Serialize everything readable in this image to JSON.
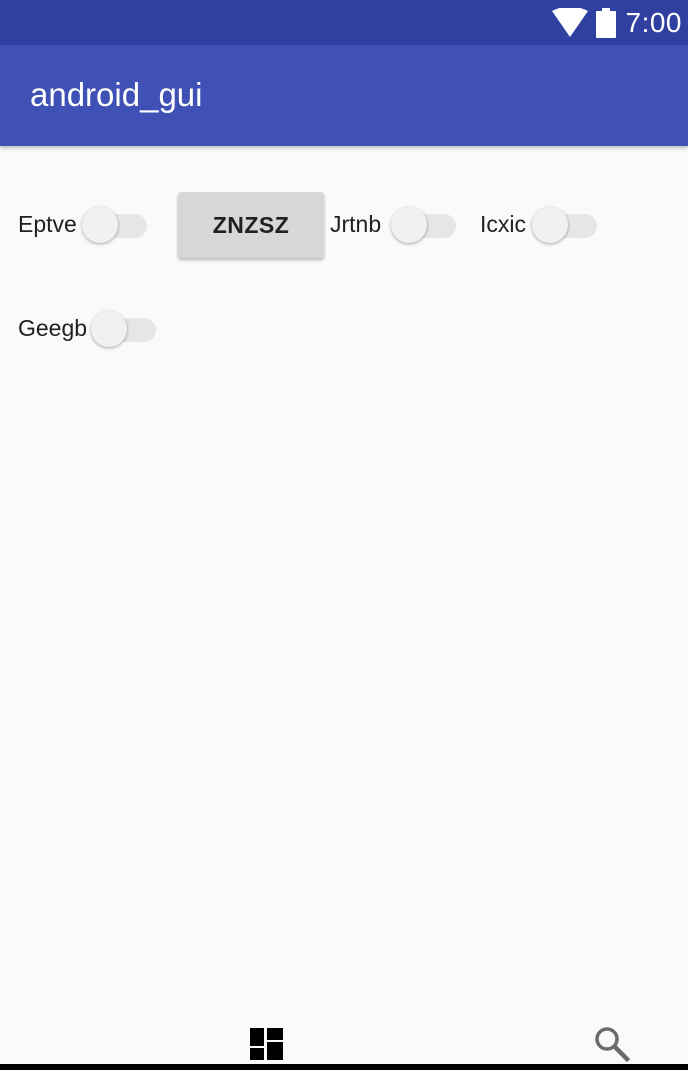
{
  "status_bar": {
    "time": "7:00",
    "icons": [
      "wifi-icon",
      "battery-icon"
    ]
  },
  "app_bar": {
    "title": "android_gui"
  },
  "content": {
    "switches": [
      {
        "label": "Eptve",
        "checked": false
      },
      {
        "label": "Jrtnb",
        "checked": false
      },
      {
        "label": "Icxic",
        "checked": false
      },
      {
        "label": "Geegb",
        "checked": false
      }
    ],
    "button_label": "ZNZSZ"
  },
  "bottom_nav": {
    "icons": [
      "dashboard-icon",
      "search-icon"
    ]
  },
  "colors": {
    "status_bar": "#3040a0",
    "app_bar": "#3f51b5",
    "background": "#fafafa",
    "button": "#d6d7d7"
  }
}
